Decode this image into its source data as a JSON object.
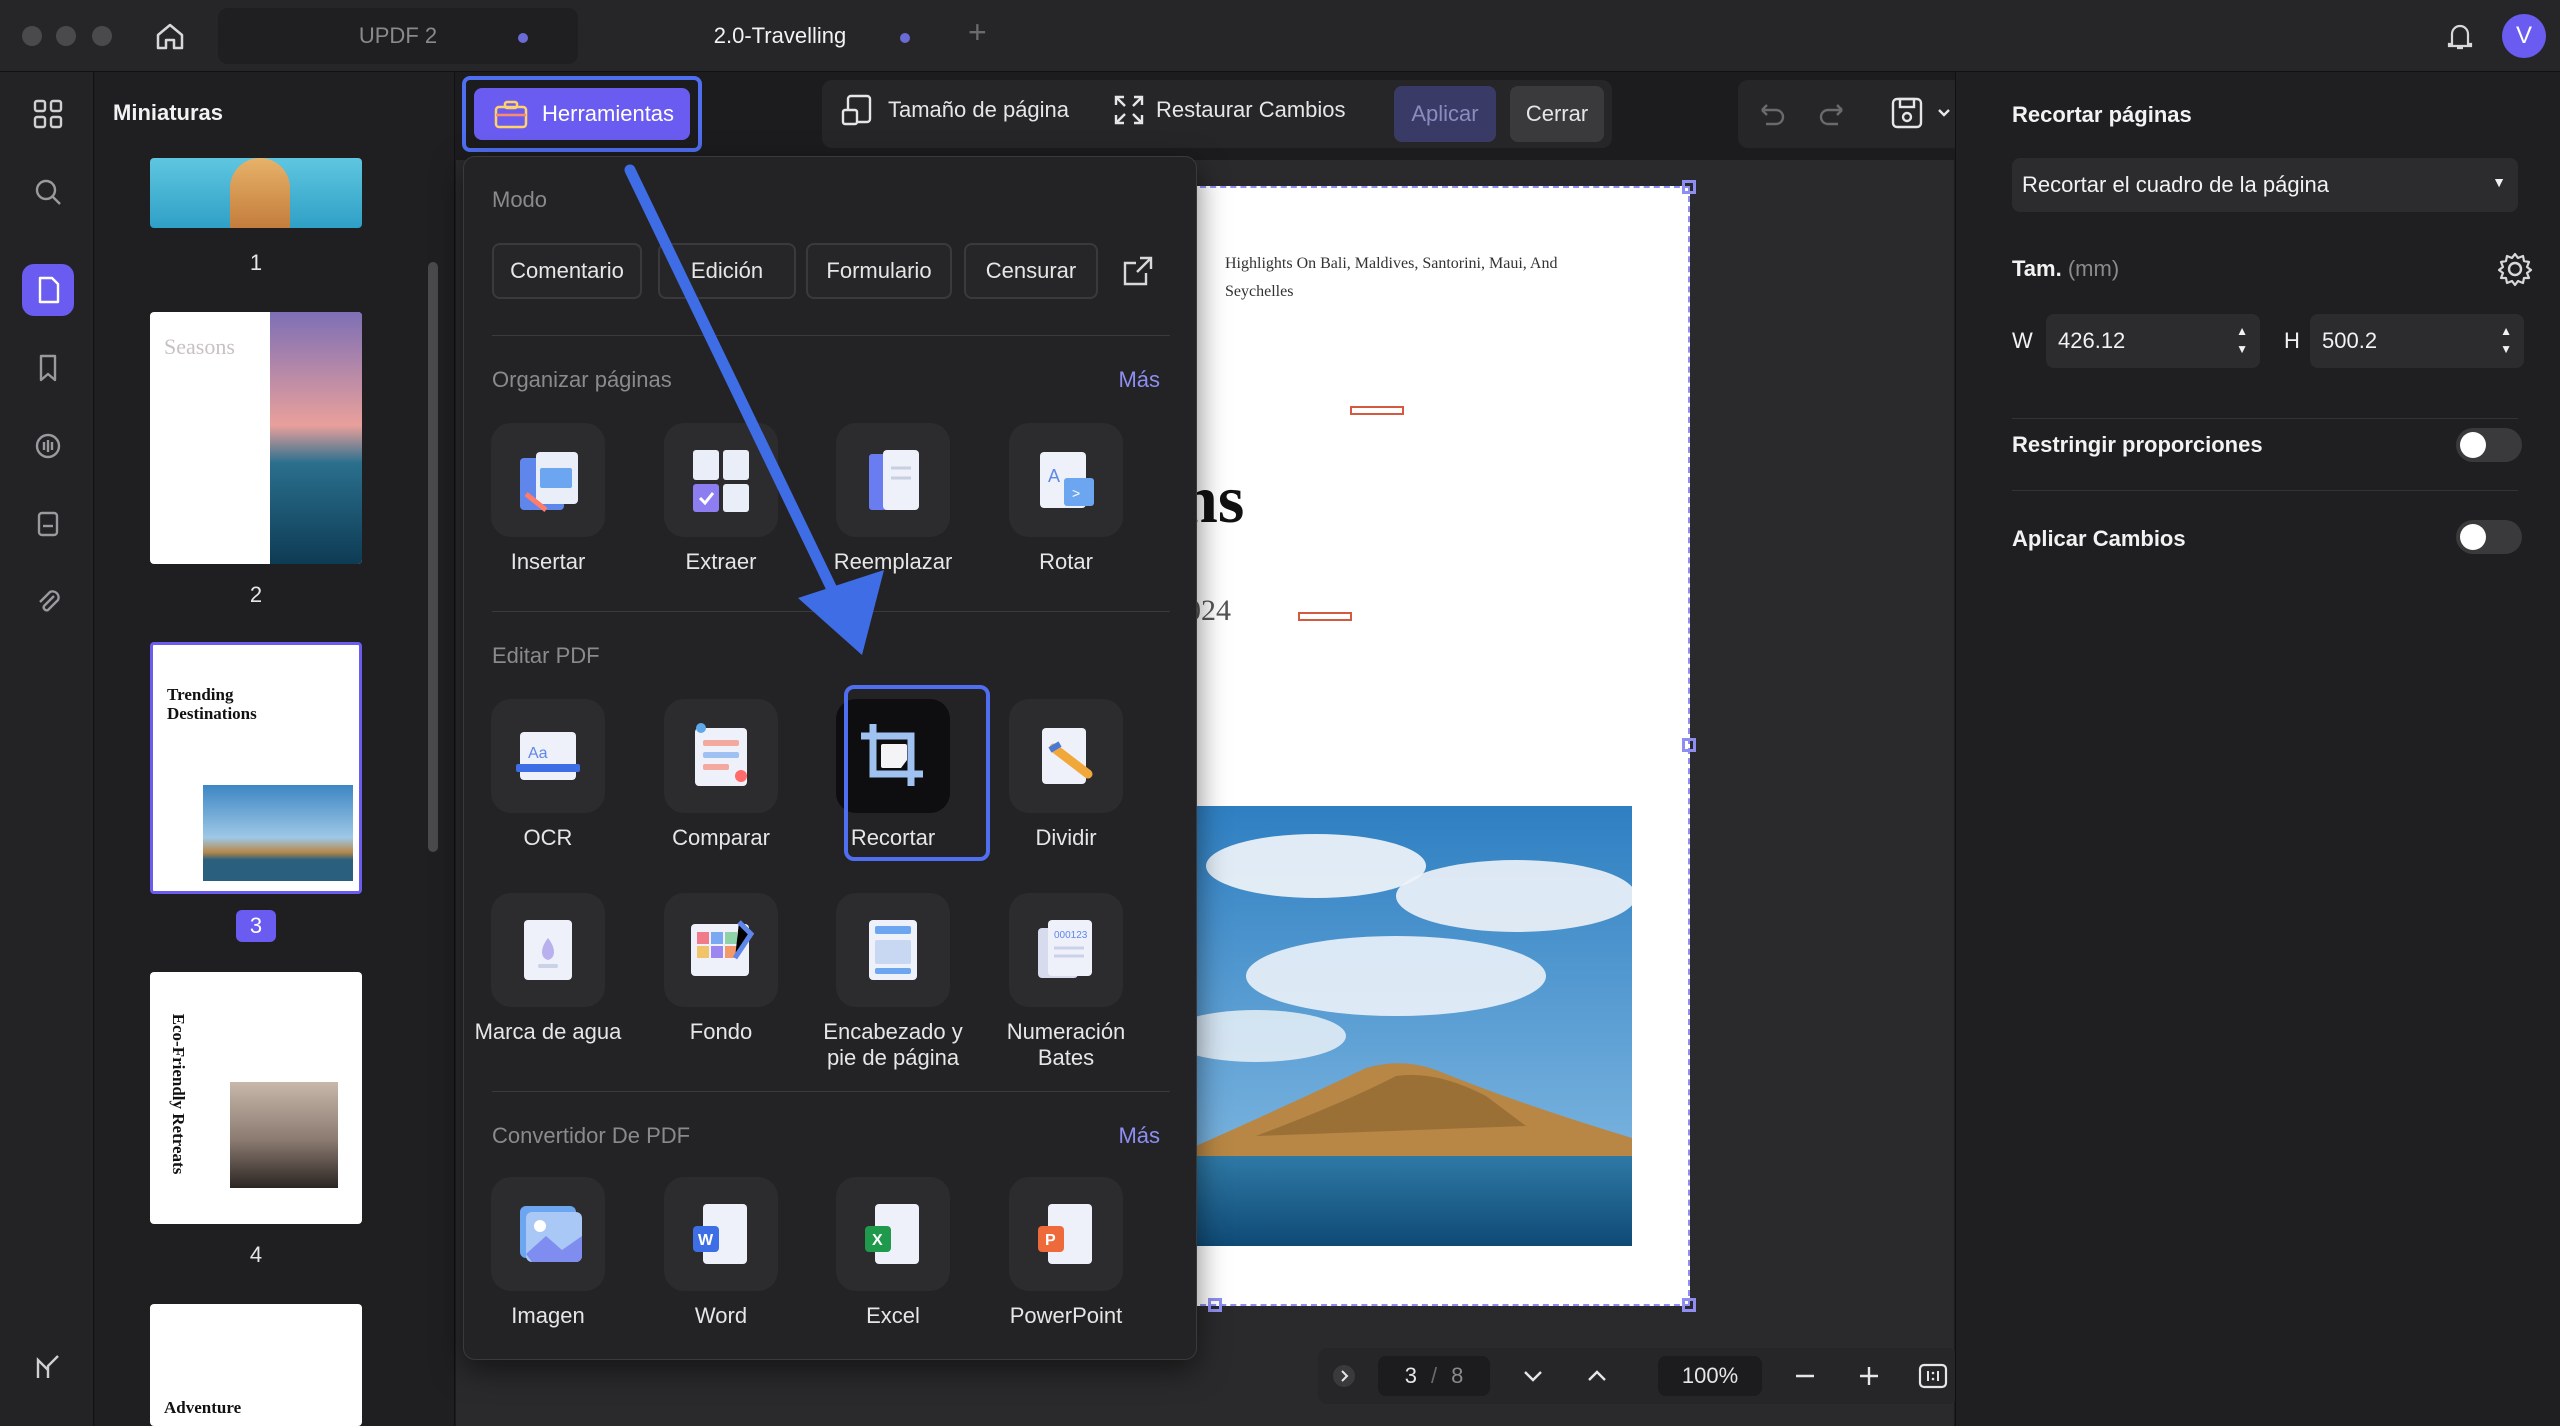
{
  "window": {
    "tabs": [
      {
        "label": "UPDF 2",
        "active": false
      },
      {
        "label": "2.0-Travelling",
        "active": true
      }
    ],
    "avatar_letter": "V"
  },
  "thumbnails": {
    "title": "Miniaturas",
    "pages": [
      {
        "num": "1"
      },
      {
        "num": "2",
        "text": "Seasons"
      },
      {
        "num": "3",
        "text": "Trending Destinations",
        "selected": true
      },
      {
        "num": "4",
        "text": "Eco-Friendly Retreats"
      },
      {
        "num": "",
        "text": "Adventure"
      }
    ]
  },
  "toolbar": {
    "tools_label": "Herramientas",
    "page_size_label": "Tamaño de página",
    "restore_label": "Restaurar Cambios",
    "apply_label": "Aplicar",
    "close_label": "Cerrar"
  },
  "tools_menu": {
    "mode": {
      "title": "Modo",
      "buttons": [
        "Comentario",
        "Edición",
        "Formulario",
        "Censurar"
      ]
    },
    "organize": {
      "title": "Organizar páginas",
      "more": "Más",
      "items": [
        "Insertar",
        "Extraer",
        "Reemplazar",
        "Rotar"
      ]
    },
    "edit": {
      "title": "Editar PDF",
      "items": [
        "OCR",
        "Comparar",
        "Recortar",
        "Dividir",
        "Marca de agua",
        "Fondo",
        "Encabezado y pie de página",
        "Numeración Bates"
      ]
    },
    "convert": {
      "title": "Convertidor De PDF",
      "more": "Más",
      "items": [
        "Imagen",
        "Word",
        "Excel",
        "PowerPoint"
      ]
    }
  },
  "document": {
    "header_text": "Highlights On Bali, Maldives, Santorini, Maui, And Seychelles",
    "partial_title": "ns",
    "partial_year": "024"
  },
  "page_nav": {
    "current": "3",
    "separator": "/",
    "total": "8",
    "zoom": "100%"
  },
  "right_panel": {
    "title": "Recortar páginas",
    "crop_mode": "Recortar el cuadro de la página",
    "size_label": "Tam.",
    "size_unit": "(mm)",
    "width_label": "W",
    "width_value": "426.12",
    "height_label": "H",
    "height_value": "500.2",
    "restrict_label": "Restringir proporciones",
    "restrict_on": false,
    "apply_changes_label": "Aplicar Cambios",
    "apply_changes_on": false
  },
  "colors": {
    "accent": "#6a5cf0",
    "highlight_border": "#4f6ef0",
    "crop_border": "#8e8ef2"
  }
}
